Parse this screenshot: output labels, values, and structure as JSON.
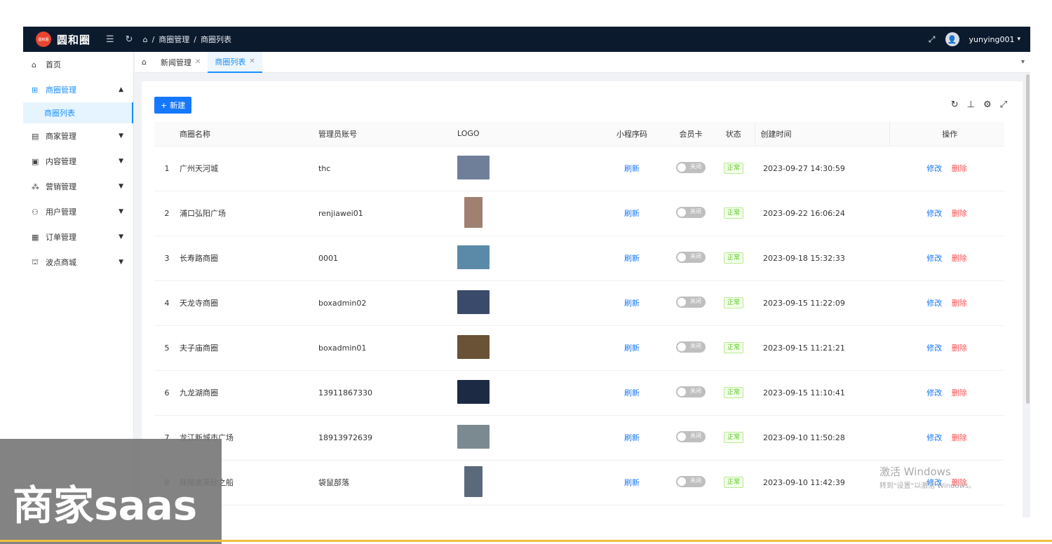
{
  "app": {
    "brand": "圆和圈",
    "logo_text": "圆和圈"
  },
  "breadcrumb": [
    "商圈管理",
    "商圈列表"
  ],
  "user": {
    "name": "yunying001"
  },
  "sidebar": {
    "items": [
      {
        "label": "首页",
        "icon": "home-icon"
      },
      {
        "label": "商圈管理",
        "icon": "cluster-icon",
        "sub": [
          "商圈列表"
        ]
      },
      {
        "label": "商家管理",
        "icon": "shop-icon"
      },
      {
        "label": "内容管理",
        "icon": "content-icon"
      },
      {
        "label": "营销管理",
        "icon": "marketing-icon"
      },
      {
        "label": "用户管理",
        "icon": "users-icon"
      },
      {
        "label": "订单管理",
        "icon": "order-icon"
      },
      {
        "label": "波点商城",
        "icon": "mall-icon"
      }
    ]
  },
  "tabs": [
    {
      "label": "新闻管理"
    },
    {
      "label": "商圈列表"
    }
  ],
  "toolbar": {
    "new_label": "新建"
  },
  "table": {
    "headers": {
      "name": "商圈名称",
      "admin": "管理员账号",
      "logo": "LOGO",
      "mini": "小程序码",
      "card": "会员卡",
      "status": "状态",
      "time": "创建时间",
      "op": "操作"
    },
    "rows": [
      {
        "idx": "1",
        "name": "广州天河城",
        "admin": "thc",
        "mini": "刷新",
        "card": "关闭",
        "status": "正常",
        "time": "2023-09-27 14:30:59",
        "edit": "修改",
        "del": "删除",
        "logo_color": "#6f7f9a"
      },
      {
        "idx": "2",
        "name": "浦口弘阳广场",
        "admin": "renjiawei01",
        "mini": "刷新",
        "card": "关闭",
        "status": "正常",
        "time": "2023-09-22 16:06:24",
        "edit": "修改",
        "del": "删除",
        "logo_color": "#a08070"
      },
      {
        "idx": "3",
        "name": "长寿路商圈",
        "admin": "0001",
        "mini": "刷新",
        "card": "关闭",
        "status": "正常",
        "time": "2023-09-18 15:32:33",
        "edit": "修改",
        "del": "删除",
        "logo_color": "#5a8aa8"
      },
      {
        "idx": "4",
        "name": "天龙寺商圈",
        "admin": "boxadmin02",
        "mini": "刷新",
        "card": "关闭",
        "status": "正常",
        "time": "2023-09-15 11:22:09",
        "edit": "修改",
        "del": "删除",
        "logo_color": "#3a4a6a"
      },
      {
        "idx": "5",
        "name": "夫子庙商圈",
        "admin": "boxadmin01",
        "mini": "刷新",
        "card": "关闭",
        "status": "正常",
        "time": "2023-09-15 11:21:21",
        "edit": "修改",
        "del": "删除",
        "logo_color": "#6a5236"
      },
      {
        "idx": "6",
        "name": "九龙湖商圈",
        "admin": "13911867330",
        "mini": "刷新",
        "card": "关闭",
        "status": "正常",
        "time": "2023-09-15 11:10:41",
        "edit": "修改",
        "del": "删除",
        "logo_color": "#1d2a44"
      },
      {
        "idx": "7",
        "name": "龙江新城市广场",
        "admin": "18913972639",
        "mini": "刷新",
        "card": "关闭",
        "status": "正常",
        "time": "2023-09-10 11:50:28",
        "edit": "修改",
        "del": "删除",
        "logo_color": "#7a8a90"
      },
      {
        "idx": "8",
        "name": "秣陵奥莱砂之船",
        "admin": "袋鼠部落",
        "mini": "刷新",
        "card": "关闭",
        "status": "正常",
        "time": "2023-09-10 11:42:39",
        "edit": "修改",
        "del": "删除",
        "logo_color": "#5a6a7a"
      }
    ]
  },
  "overlay": {
    "text": "商家saas"
  },
  "watermark": {
    "title": "激活 Windows",
    "subtitle": "转到\"设置\"以激活 Windows。"
  },
  "colors": {
    "topbar": "#0c1a2e",
    "primary": "#1677ff",
    "danger": "#ff4d4f",
    "success": "#52c41a"
  }
}
